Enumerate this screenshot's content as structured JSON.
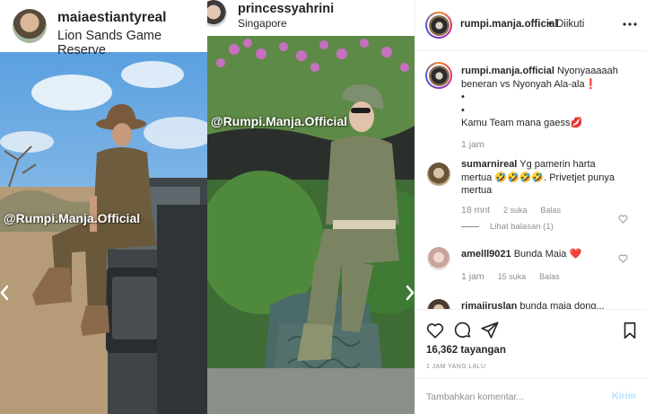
{
  "panels": {
    "left": {
      "username": "maiaestiantyreal",
      "location": "Lion Sands Game Reserve",
      "watermark": "@Rumpi.Manja.Official"
    },
    "right": {
      "username": "princessyahrini",
      "location": "Singapore",
      "watermark": "@Rumpi.Manja.Official"
    }
  },
  "post": {
    "username": "rumpi.manja.official",
    "separator": "•",
    "follow_status": "Diikuti",
    "views": "16,362 tayangan",
    "time_ago": "1 JAM YANG LALU"
  },
  "caption": {
    "username": "rumpi.manja.official",
    "line1": "Nyonyaaaaah beneran vs Nyonyah Ala-ala",
    "line1_emoji": "❗",
    "dot1": "•",
    "dot2": "•",
    "line2": "Kamu Team mana gaess",
    "line2_emoji": "💋",
    "time": "1 jam"
  },
  "comments": [
    {
      "username": "sumarnireal",
      "text": "Yg pamerin harta mertua",
      "emoji": "🤣🤣🤣🤣",
      "text2": ". Privetjet punya mertua",
      "time": "18 mnt",
      "likes": "2 suka",
      "reply": "Balas",
      "view_replies": "Lihat balasan (1)"
    },
    {
      "username": "amelll9021",
      "text": "Bunda Maia",
      "emoji": "❤️",
      "time": "1 jam",
      "likes": "15 suka",
      "reply": "Balas"
    },
    {
      "username": "rimajiruslan",
      "text": "bunda maia dong..."
    }
  ],
  "add_comment": {
    "placeholder": "Tambahkan komentar...",
    "post_label": "Kirim"
  },
  "colors": {
    "border": "#efefef",
    "muted": "#8e8e8e",
    "text": "#262626",
    "post_disabled": "#b2dffc",
    "heart_red": "#ed4956"
  }
}
